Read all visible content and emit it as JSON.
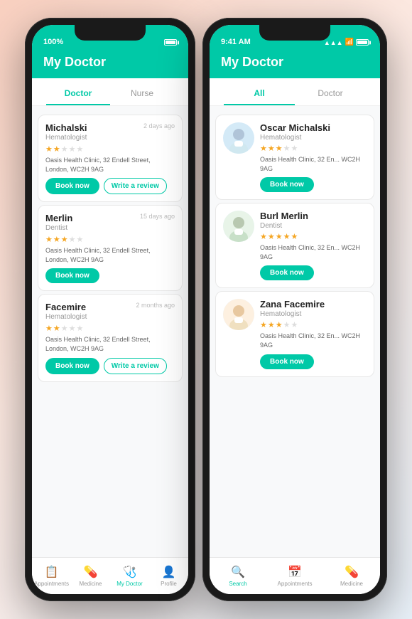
{
  "app": {
    "title": "My Doctor"
  },
  "left_phone": {
    "status": {
      "time": "100%",
      "battery_full": true
    },
    "tabs": [
      {
        "label": "Doctor",
        "active": true
      },
      {
        "label": "Nurse",
        "active": false
      }
    ],
    "doctors": [
      {
        "id": "michalski",
        "name": "Michalski",
        "specialty": "Hematologist",
        "time_ago": "2 days ago",
        "rating": 2,
        "max_rating": 5,
        "address": "Oasis Health Clinic, 32 Endell Street, London, WC2H 9AG",
        "has_review": true,
        "book_label": "Book now",
        "review_label": "Write a review"
      },
      {
        "id": "merlin",
        "name": "Merlin",
        "specialty": "Dentist",
        "time_ago": "15 days ago",
        "rating": 3,
        "max_rating": 5,
        "address": "Oasis Health Clinic, 32 Endell Street, London, WC2H 9AG",
        "has_review": false,
        "book_label": "Book now",
        "review_label": ""
      },
      {
        "id": "facemire",
        "name": "Facemire",
        "specialty": "Hematologist",
        "time_ago": "2 months ago",
        "rating": 2,
        "max_rating": 5,
        "address": "Oasis Health Clinic, 32 Endell Street, London, WC2H 9AG",
        "has_review": true,
        "book_label": "Book now",
        "review_label": "Write a review"
      }
    ],
    "nav": [
      {
        "icon": "📋",
        "label": "Appointments",
        "active": false
      },
      {
        "icon": "💊",
        "label": "Medicine",
        "active": false
      },
      {
        "icon": "🩺",
        "label": "My Doctor",
        "active": true
      },
      {
        "icon": "👤",
        "label": "Profile",
        "active": false
      }
    ]
  },
  "right_phone": {
    "status": {
      "time": "9:41 AM"
    },
    "tabs": [
      {
        "label": "All",
        "active": true
      },
      {
        "label": "Doctor",
        "active": false
      }
    ],
    "doctors": [
      {
        "id": "oscar-michalski",
        "name": "Oscar Michalski",
        "specialty": "Hematologist",
        "rating": 3,
        "max_rating": 5,
        "address": "Oasis Health Clinic, 32 En... WC2H 9AG",
        "book_label": "Book now"
      },
      {
        "id": "burl-merlin",
        "name": "Burl Merlin",
        "specialty": "Dentist",
        "rating": 5,
        "max_rating": 5,
        "address": "Oasis Health Clinic, 32 En... WC2H 9AG",
        "book_label": "Book now"
      },
      {
        "id": "zana-facemire",
        "name": "Zana Facemire",
        "specialty": "Hematologist",
        "rating": 3,
        "max_rating": 5,
        "address": "Oasis Health Clinic, 32 En... WC2H 9AG",
        "book_label": "Book now"
      }
    ],
    "nav": [
      {
        "icon": "🔍",
        "label": "Search",
        "active": true
      },
      {
        "icon": "📅",
        "label": "Appointments",
        "active": false
      },
      {
        "icon": "💊",
        "label": "Medicine",
        "active": false
      }
    ]
  }
}
